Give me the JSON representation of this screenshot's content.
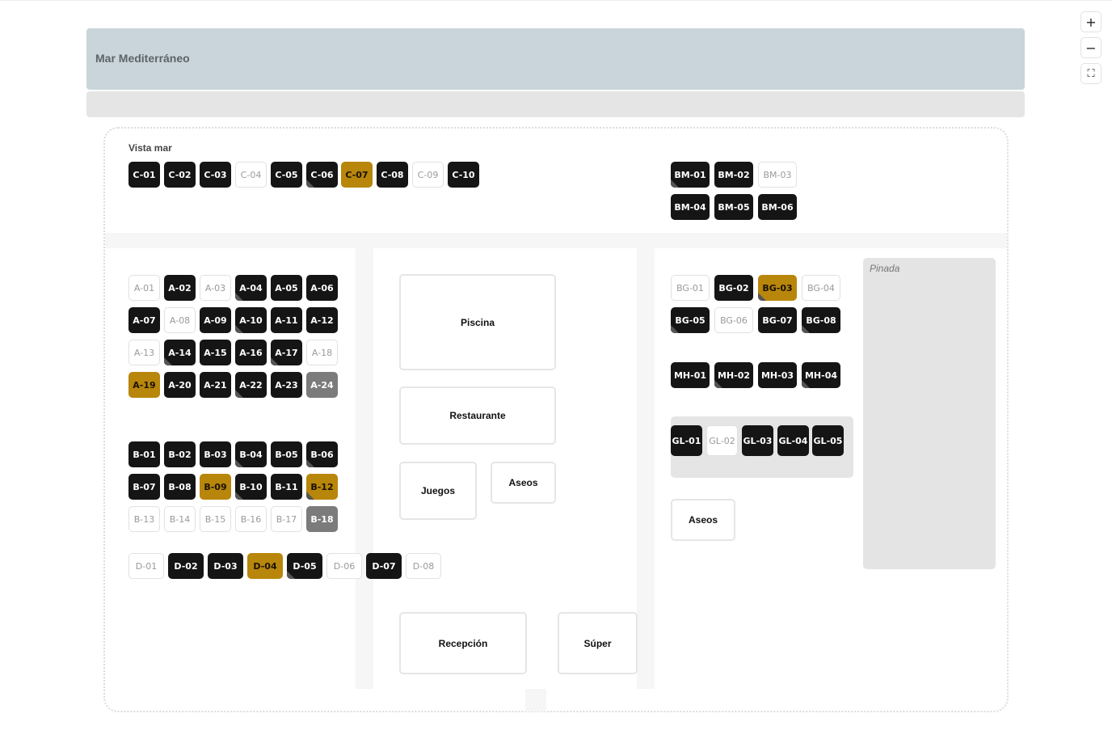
{
  "map": {
    "sea_label": "Mar Mediterráneo",
    "row_c_label": "Vista mar",
    "pinada_label": "Pinada"
  },
  "controls": {
    "zoom_in": "+",
    "zoom_out": "−",
    "fit": "⛶"
  },
  "facilities": {
    "pool": "Piscina",
    "restaurant": "Restaurante",
    "games": "Juegos",
    "toilets_center": "Aseos",
    "reception": "Recepción",
    "super": "Súper",
    "toilets_right": "Aseos"
  },
  "statuses": {
    "occupied": "#151515",
    "free": "#ffffff",
    "selected": "#b8860b",
    "blocked": "#7b7b7b"
  },
  "rows": {
    "C": [
      {
        "id": "C-01",
        "status": "occupied"
      },
      {
        "id": "C-02",
        "status": "occupied"
      },
      {
        "id": "C-03",
        "status": "occupied"
      },
      {
        "id": "C-04",
        "status": "free"
      },
      {
        "id": "C-05",
        "status": "occupied"
      },
      {
        "id": "C-06",
        "status": "occupied",
        "fold": true
      },
      {
        "id": "C-07",
        "status": "gold"
      },
      {
        "id": "C-08",
        "status": "occupied"
      },
      {
        "id": "C-09",
        "status": "free"
      },
      {
        "id": "C-10",
        "status": "occupied"
      }
    ],
    "BM": [
      {
        "id": "BM-01",
        "status": "occupied",
        "fold": true
      },
      {
        "id": "BM-02",
        "status": "occupied"
      },
      {
        "id": "BM-03",
        "status": "free"
      },
      {
        "id": "BM-04",
        "status": "occupied"
      },
      {
        "id": "BM-05",
        "status": "occupied"
      },
      {
        "id": "BM-06",
        "status": "occupied"
      }
    ],
    "A": [
      {
        "id": "A-01",
        "status": "free"
      },
      {
        "id": "A-02",
        "status": "occupied"
      },
      {
        "id": "A-03",
        "status": "free"
      },
      {
        "id": "A-04",
        "status": "occupied",
        "fold": true
      },
      {
        "id": "A-05",
        "status": "occupied"
      },
      {
        "id": "A-06",
        "status": "occupied"
      },
      {
        "id": "A-07",
        "status": "occupied"
      },
      {
        "id": "A-08",
        "status": "free"
      },
      {
        "id": "A-09",
        "status": "occupied"
      },
      {
        "id": "A-10",
        "status": "occupied",
        "fold": true
      },
      {
        "id": "A-11",
        "status": "occupied"
      },
      {
        "id": "A-12",
        "status": "occupied"
      },
      {
        "id": "A-13",
        "status": "free"
      },
      {
        "id": "A-14",
        "status": "occupied",
        "fold": true
      },
      {
        "id": "A-15",
        "status": "occupied"
      },
      {
        "id": "A-16",
        "status": "occupied"
      },
      {
        "id": "A-17",
        "status": "occupied",
        "fold": true
      },
      {
        "id": "A-18",
        "status": "free"
      },
      {
        "id": "A-19",
        "status": "gold"
      },
      {
        "id": "A-20",
        "status": "occupied"
      },
      {
        "id": "A-21",
        "status": "occupied"
      },
      {
        "id": "A-22",
        "status": "occupied",
        "fold": true
      },
      {
        "id": "A-23",
        "status": "occupied"
      },
      {
        "id": "A-24",
        "status": "gray"
      }
    ],
    "B": [
      {
        "id": "B-01",
        "status": "occupied"
      },
      {
        "id": "B-02",
        "status": "occupied"
      },
      {
        "id": "B-03",
        "status": "occupied"
      },
      {
        "id": "B-04",
        "status": "occupied",
        "fold": true
      },
      {
        "id": "B-05",
        "status": "occupied"
      },
      {
        "id": "B-06",
        "status": "occupied",
        "fold": true
      },
      {
        "id": "B-07",
        "status": "occupied"
      },
      {
        "id": "B-08",
        "status": "occupied"
      },
      {
        "id": "B-09",
        "status": "gold"
      },
      {
        "id": "B-10",
        "status": "occupied",
        "fold": true
      },
      {
        "id": "B-11",
        "status": "occupied"
      },
      {
        "id": "B-12",
        "status": "gold",
        "fold": true
      },
      {
        "id": "B-13",
        "status": "free"
      },
      {
        "id": "B-14",
        "status": "free"
      },
      {
        "id": "B-15",
        "status": "free"
      },
      {
        "id": "B-16",
        "status": "free"
      },
      {
        "id": "B-17",
        "status": "free"
      },
      {
        "id": "B-18",
        "status": "gray"
      }
    ],
    "D": [
      {
        "id": "D-01",
        "status": "free"
      },
      {
        "id": "D-02",
        "status": "occupied"
      },
      {
        "id": "D-03",
        "status": "occupied"
      },
      {
        "id": "D-04",
        "status": "gold"
      },
      {
        "id": "D-05",
        "status": "occupied",
        "fold": true
      },
      {
        "id": "D-06",
        "status": "free"
      },
      {
        "id": "D-07",
        "status": "occupied"
      },
      {
        "id": "D-08",
        "status": "free"
      }
    ],
    "BG": [
      {
        "id": "BG-01",
        "status": "free"
      },
      {
        "id": "BG-02",
        "status": "occupied"
      },
      {
        "id": "BG-03",
        "status": "gold",
        "fold": true
      },
      {
        "id": "BG-04",
        "status": "free"
      },
      {
        "id": "BG-05",
        "status": "occupied",
        "fold": true
      },
      {
        "id": "BG-06",
        "status": "free"
      },
      {
        "id": "BG-07",
        "status": "occupied"
      },
      {
        "id": "BG-08",
        "status": "occupied",
        "fold": true
      }
    ],
    "MH": [
      {
        "id": "MH-01",
        "status": "occupied"
      },
      {
        "id": "MH-02",
        "status": "occupied",
        "fold": true
      },
      {
        "id": "MH-03",
        "status": "occupied"
      },
      {
        "id": "MH-04",
        "status": "occupied",
        "fold": true
      }
    ],
    "GL": [
      {
        "id": "GL-01",
        "status": "occupied"
      },
      {
        "id": "GL-02",
        "status": "free"
      },
      {
        "id": "GL-03",
        "status": "occupied"
      },
      {
        "id": "GL-04",
        "status": "occupied"
      },
      {
        "id": "GL-05",
        "status": "occupied"
      }
    ]
  }
}
